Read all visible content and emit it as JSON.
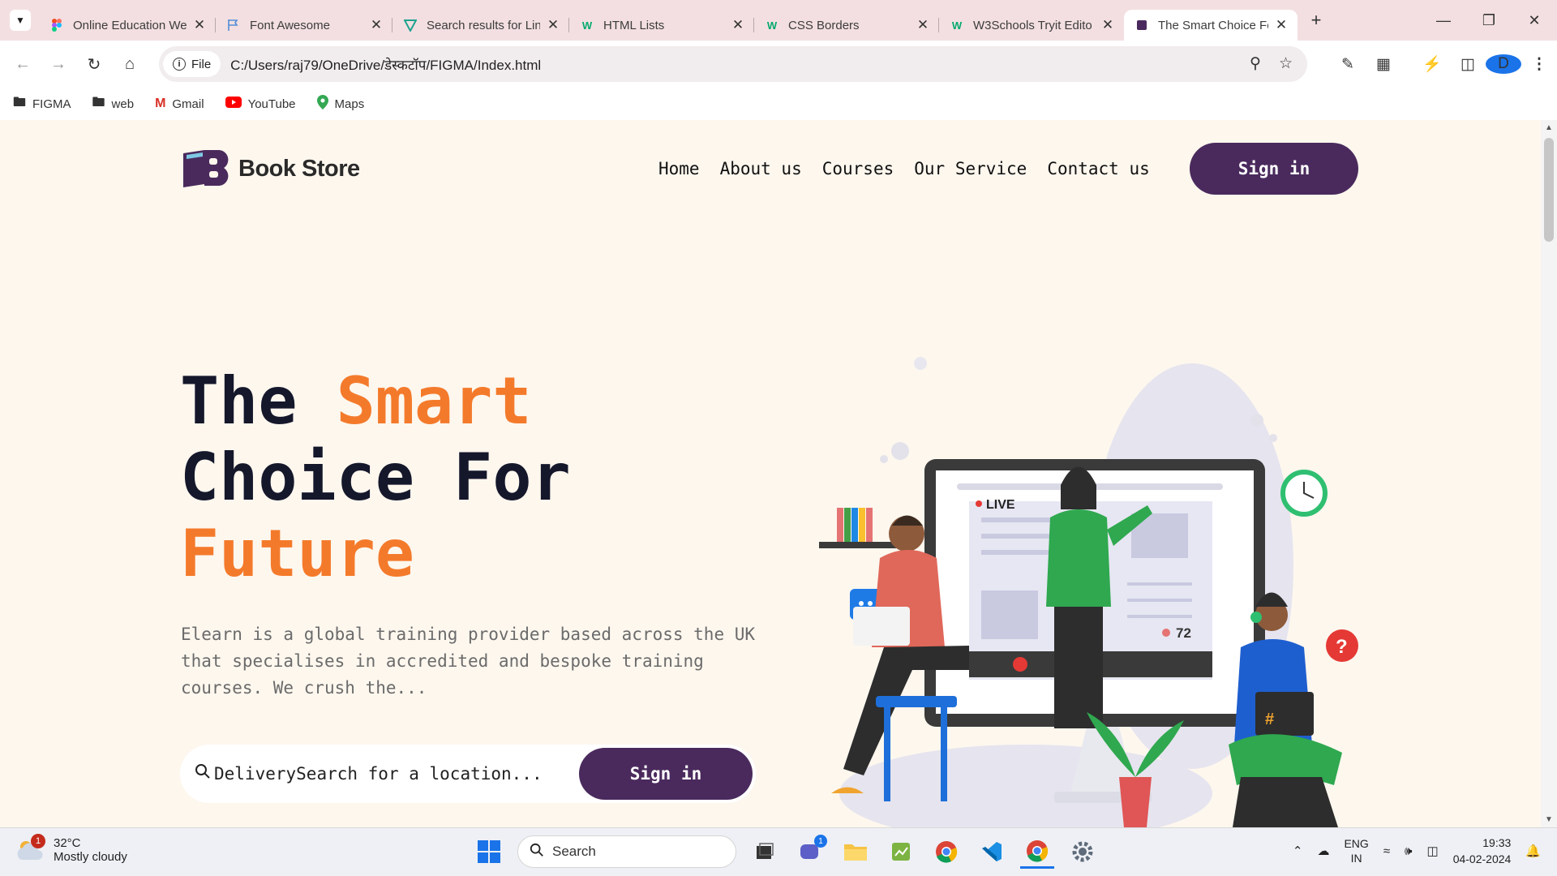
{
  "browser": {
    "tabs": [
      {
        "title": "Online Education We",
        "icon": "figma-icon",
        "active": false
      },
      {
        "title": "Font Awesome",
        "icon": "flag-icon",
        "active": false
      },
      {
        "title": "Search results for Lin",
        "icon": "vee-icon",
        "active": false
      },
      {
        "title": "HTML Lists",
        "icon": "w3schools-icon",
        "active": false
      },
      {
        "title": "CSS Borders",
        "icon": "w3schools-icon",
        "active": false
      },
      {
        "title": "W3Schools Tryit Edito",
        "icon": "w3schools-icon",
        "active": false
      },
      {
        "title": "The Smart Choice Fo",
        "icon": "bookstore-icon",
        "active": true
      }
    ],
    "omnibox": {
      "chip": "File",
      "url": "C:/Users/raj79/OneDrive/डेस्कटॉप/FIGMA/Index.html"
    },
    "profile_initial": "D",
    "bookmarks": [
      {
        "label": "FIGMA",
        "icon": "folder-icon"
      },
      {
        "label": "web",
        "icon": "folder-icon"
      },
      {
        "label": "Gmail",
        "icon": "gmail-icon"
      },
      {
        "label": "YouTube",
        "icon": "youtube-icon"
      },
      {
        "label": "Maps",
        "icon": "maps-icon"
      }
    ]
  },
  "site": {
    "brand": "Book Store",
    "nav": [
      "Home",
      "About us",
      "Courses",
      "Our Service",
      "Contact us"
    ],
    "signin_label": "Sign in",
    "hero": {
      "line1_a": "The ",
      "line1_b": "Smart",
      "line2": "Choice For",
      "line3": "Future"
    },
    "description": "Elearn is a global training provider based across the UK that specialises in accredited and bespoke training courses. We crush the...",
    "search": {
      "label": "Delivery",
      "placeholder": "Search for a location...",
      "button": "Sign in"
    },
    "illustration": {
      "live_label": "LIVE",
      "viewer_count": "72"
    }
  },
  "taskbar": {
    "weather": {
      "temp": "32°C",
      "condition": "Mostly cloudy",
      "badge": "1"
    },
    "search_label": "Search",
    "teams_badge": "1",
    "lang_line1": "ENG",
    "lang_line2": "IN",
    "time": "19:33",
    "date": "04-02-2024"
  },
  "colors": {
    "accent": "#4a2a5d",
    "highlight": "#f47a2b",
    "background": "#fdf7ee"
  }
}
